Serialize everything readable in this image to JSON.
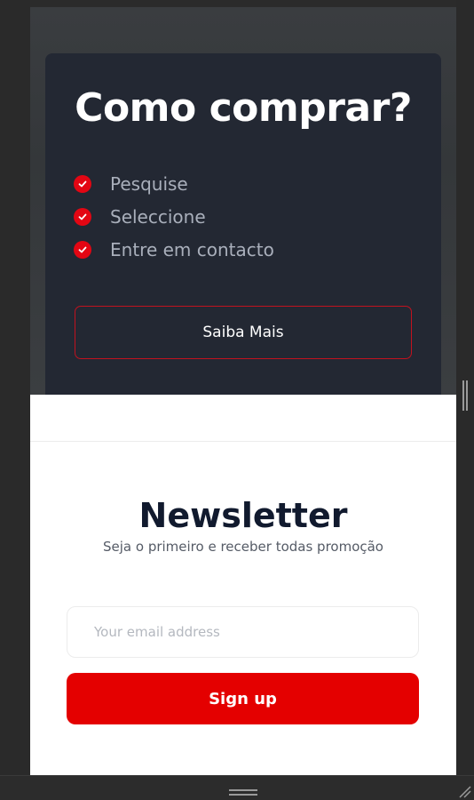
{
  "hero": {
    "title": "Como comprar?",
    "steps": [
      {
        "label": "Pesquise",
        "icon": "check-circle-icon"
      },
      {
        "label": "Seleccione",
        "icon": "check-circle-icon"
      },
      {
        "label": "Entre em contacto",
        "icon": "check-circle-icon"
      }
    ],
    "cta_label": "Saiba Mais"
  },
  "newsletter": {
    "title": "Newsletter",
    "subtitle": "Seja o primeiro e receber todas promoção",
    "email_placeholder": "Your email address",
    "email_value": "",
    "signup_label": "Sign up"
  },
  "colors": {
    "accent": "#e40000",
    "card_bg": "#232833",
    "heading": "#111a2e"
  }
}
